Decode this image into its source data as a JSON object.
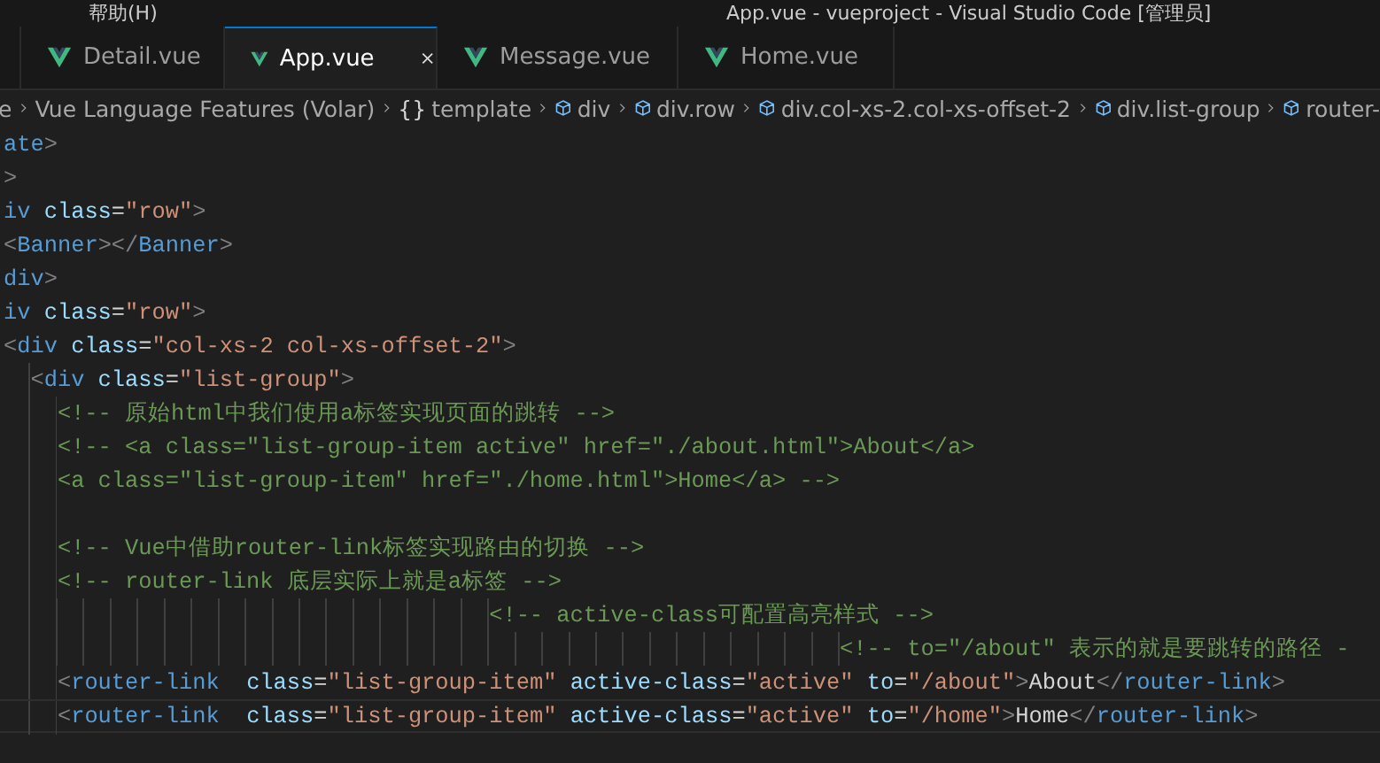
{
  "title_bar": {
    "menu": [
      "帮助(H)"
    ],
    "title": "App.vue - vueproject - Visual Studio Code [管理员]"
  },
  "tabs": [
    {
      "label": "Detail.vue",
      "selected": false
    },
    {
      "label": "App.vue",
      "selected": true
    },
    {
      "label": "Message.vue",
      "selected": false
    },
    {
      "label": "Home.vue",
      "selected": false
    }
  ],
  "breadcrumbs": [
    {
      "kind": "plain",
      "label": "e"
    },
    {
      "kind": "plain",
      "label": "Vue Language Features (Volar)"
    },
    {
      "kind": "symbol",
      "symbol": "{}",
      "label": "template"
    },
    {
      "kind": "element",
      "label": "div"
    },
    {
      "kind": "element",
      "label": "div.row"
    },
    {
      "kind": "element",
      "label": "div.col-xs-2.col-xs-offset-2"
    },
    {
      "kind": "element",
      "label": "div.list-group"
    },
    {
      "kind": "element",
      "label": "router-"
    }
  ],
  "editor": {
    "lines": [
      {
        "current": false,
        "tokens": [
          {
            "kind": "t",
            "text": "ate"
          },
          {
            "kind": "p",
            "text": ">"
          }
        ]
      },
      {
        "current": false,
        "tokens": [
          {
            "kind": "p",
            "text": ">"
          }
        ]
      },
      {
        "current": false,
        "tokens": [
          {
            "kind": "t",
            "text": "iv"
          },
          {
            "kind": "a",
            "text": " class"
          },
          {
            "kind": "x",
            "text": "="
          },
          {
            "kind": "s",
            "text": "\"row\""
          },
          {
            "kind": "p",
            "text": ">"
          }
        ]
      },
      {
        "current": false,
        "tokens": [
          {
            "kind": "p",
            "text": "<"
          },
          {
            "kind": "t",
            "text": "Banner"
          },
          {
            "kind": "p",
            "text": "></"
          },
          {
            "kind": "t",
            "text": "Banner"
          },
          {
            "kind": "p",
            "text": ">"
          }
        ]
      },
      {
        "current": false,
        "tokens": [
          {
            "kind": "t",
            "text": "div"
          },
          {
            "kind": "p",
            "text": ">"
          }
        ]
      },
      {
        "current": false,
        "tokens": [
          {
            "kind": "t",
            "text": "iv"
          },
          {
            "kind": "a",
            "text": " class"
          },
          {
            "kind": "x",
            "text": "="
          },
          {
            "kind": "s",
            "text": "\"row\""
          },
          {
            "kind": "p",
            "text": ">"
          }
        ]
      },
      {
        "current": false,
        "tokens": [
          {
            "kind": "p",
            "text": "<"
          },
          {
            "kind": "t",
            "text": "div"
          },
          {
            "kind": "a",
            "text": " class"
          },
          {
            "kind": "x",
            "text": "="
          },
          {
            "kind": "s",
            "text": "\"col-xs-2 col-xs-offset-2\""
          },
          {
            "kind": "p",
            "text": ">"
          }
        ]
      },
      {
        "current": false,
        "tokens": [
          {
            "kind": "p",
            "text": "<"
          },
          {
            "kind": "t",
            "text": "div"
          },
          {
            "kind": "a",
            "text": " class"
          },
          {
            "kind": "x",
            "text": "="
          },
          {
            "kind": "s",
            "text": "\"list-group\""
          },
          {
            "kind": "p",
            "text": ">"
          }
        ]
      },
      {
        "current": false,
        "tokens": [
          {
            "kind": "c",
            "text": "<!-- 原始html中我们使用a标签实现页面的跳转 -->"
          }
        ]
      },
      {
        "current": false,
        "tokens": [
          {
            "kind": "c",
            "text": "<!-- <a class=\"list-group-item active\" href=\"./about.html\">About</a>"
          }
        ]
      },
      {
        "current": false,
        "tokens": [
          {
            "kind": "c",
            "text": "<a class=\"list-group-item\" href=\"./home.html\">Home</a> -->"
          }
        ]
      },
      {
        "current": false
      },
      {
        "current": false,
        "tokens": [
          {
            "kind": "c",
            "text": "<!-- Vue中借助router-link标签实现路由的切换 -->"
          }
        ]
      },
      {
        "current": false,
        "tokens": [
          {
            "kind": "c",
            "text": "<!-- router-link 底层实际上就是a标签 -->"
          }
        ]
      },
      {
        "current": false,
        "tokens": [
          {
            "kind": "c",
            "text": "<!-- active-class可配置高亮样式 -->"
          }
        ]
      },
      {
        "current": false,
        "tokens": [
          {
            "kind": "c",
            "text": "<!-- to=\"/about\" 表示的就是要跳转的路径 -"
          }
        ]
      },
      {
        "current": false,
        "tokens": [
          {
            "kind": "p",
            "text": "<"
          },
          {
            "kind": "t",
            "text": "router-link"
          },
          {
            "kind": "a",
            "text": "  class"
          },
          {
            "kind": "x",
            "text": "="
          },
          {
            "kind": "s",
            "text": "\"list-group-item\""
          },
          {
            "kind": "a",
            "text": " active-class"
          },
          {
            "kind": "x",
            "text": "="
          },
          {
            "kind": "s",
            "text": "\"active\""
          },
          {
            "kind": "a",
            "text": " to"
          },
          {
            "kind": "x",
            "text": "="
          },
          {
            "kind": "s",
            "text": "\"/about\""
          },
          {
            "kind": "p",
            "text": ">"
          },
          {
            "kind": "x",
            "text": "About"
          },
          {
            "kind": "p",
            "text": "</"
          },
          {
            "kind": "t",
            "text": "router-link"
          },
          {
            "kind": "p",
            "text": ">"
          }
        ]
      },
      {
        "current": true,
        "tokens": [
          {
            "kind": "p",
            "text": "<"
          },
          {
            "kind": "t",
            "text": "router-link"
          },
          {
            "kind": "a",
            "text": "  class"
          },
          {
            "kind": "x",
            "text": "="
          },
          {
            "kind": "s",
            "text": "\"list-group-item\""
          },
          {
            "kind": "a",
            "text": " active-class"
          },
          {
            "kind": "x",
            "text": "="
          },
          {
            "kind": "s",
            "text": "\"active\""
          },
          {
            "kind": "a",
            "text": " to"
          },
          {
            "kind": "x",
            "text": "="
          },
          {
            "kind": "s",
            "text": "\"/home\""
          },
          {
            "kind": "p",
            "text": ">"
          },
          {
            "kind": "x",
            "text": "Home"
          },
          {
            "kind": "p",
            "text": "</"
          },
          {
            "kind": "t",
            "text": "router-link"
          },
          {
            "kind": "p",
            "text": ">"
          }
        ]
      }
    ]
  }
}
